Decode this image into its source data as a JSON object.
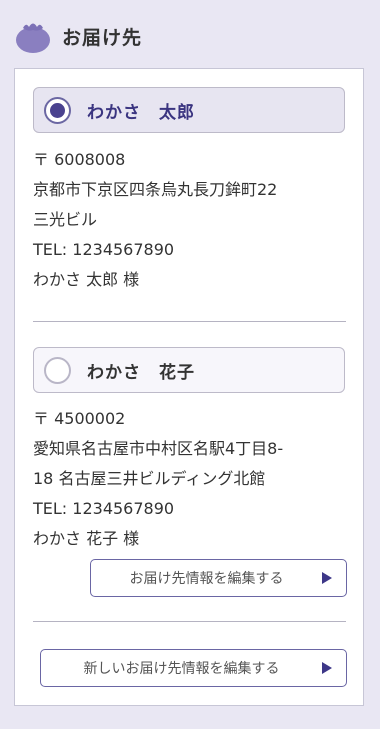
{
  "header": {
    "title": "お届け先",
    "icon": "eggplant-icon",
    "icon_color": "#8a7fc0"
  },
  "addresses": [
    {
      "name": "わかさ　太郎",
      "selected": true,
      "postal": "〒 6008008",
      "address_line1": "京都市下京区四条烏丸長刀鉾町22",
      "address_line2": "三光ビル",
      "tel": "TEL: 1234567890",
      "recipient": "わかさ 太郎 様"
    },
    {
      "name": "わかさ　花子",
      "selected": false,
      "postal": "〒 4500002",
      "address_line1": "愛知県名古屋市中村区名駅4丁目8-",
      "address_line2": "18 名古屋三井ビルディング北館",
      "tel": "TEL: 1234567890",
      "recipient": "わかさ 花子 様",
      "edit_label": "お届け先情報を編集する"
    }
  ],
  "new_address_label": "新しいお届け先情報を編集する",
  "colors": {
    "accent": "#4a428f",
    "background": "#e9e7f3",
    "border": "#6a66a4"
  }
}
